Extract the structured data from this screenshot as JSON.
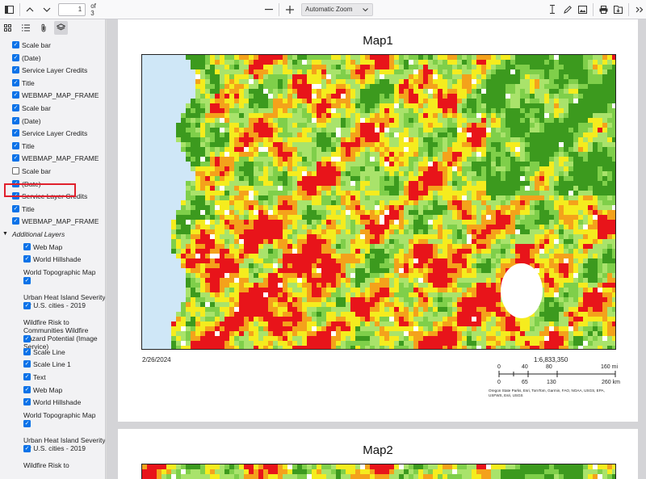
{
  "toolbar": {
    "page_number": "1",
    "page_of": "of 3",
    "zoom": "Automatic Zoom"
  },
  "layers": [
    {
      "label": "Scale bar",
      "checked": true
    },
    {
      "label": "(Date)",
      "checked": true
    },
    {
      "label": "Service Layer Credits",
      "checked": true
    },
    {
      "label": "Title",
      "checked": true
    },
    {
      "label": "WEBMAP_MAP_FRAME",
      "checked": true
    },
    {
      "label": "Scale bar",
      "checked": true
    },
    {
      "label": "(Date)",
      "checked": true
    },
    {
      "label": "Service Layer Credits",
      "checked": true
    },
    {
      "label": "Title",
      "checked": true
    },
    {
      "label": "WEBMAP_MAP_FRAME",
      "checked": true
    },
    {
      "label": "Scale bar",
      "checked": false
    },
    {
      "label": "(Date)",
      "checked": true
    },
    {
      "label": "Service Layer Credits",
      "checked": true
    },
    {
      "label": "Title",
      "checked": true
    },
    {
      "label": "WEBMAP_MAP_FRAME",
      "checked": true
    }
  ],
  "additional_layers": {
    "label": "Additional Layers",
    "items": [
      "Web Map",
      "World Hillshade",
      "World Topographic Map",
      "Urban Heat Island Severity for U.S. cities - 2019",
      "Wildfire Risk to Communities Wildfire Hazard Potential (Image Service)",
      "Scale Line",
      "Scale Line 1",
      "Text",
      "Web Map",
      "World Hillshade",
      "World Topographic Map",
      "Urban Heat Island Severity for U.S. cities - 2019",
      "Wildfire Risk to"
    ]
  },
  "page1": {
    "title": "Map1",
    "date": "2/26/2024",
    "scale": "1:6,833,350",
    "scale_mi": [
      "0",
      "40",
      "80",
      "160 mi"
    ],
    "scale_km": [
      "0",
      "65",
      "130",
      "260 km"
    ],
    "credits_line1": "Oregon State Parks, Esri, TomTom, Garmin, FAO, NOAA, USGS, EPA,",
    "credits_line2": "USFWS, Esri, USGS"
  },
  "page2": {
    "title": "Map2"
  }
}
